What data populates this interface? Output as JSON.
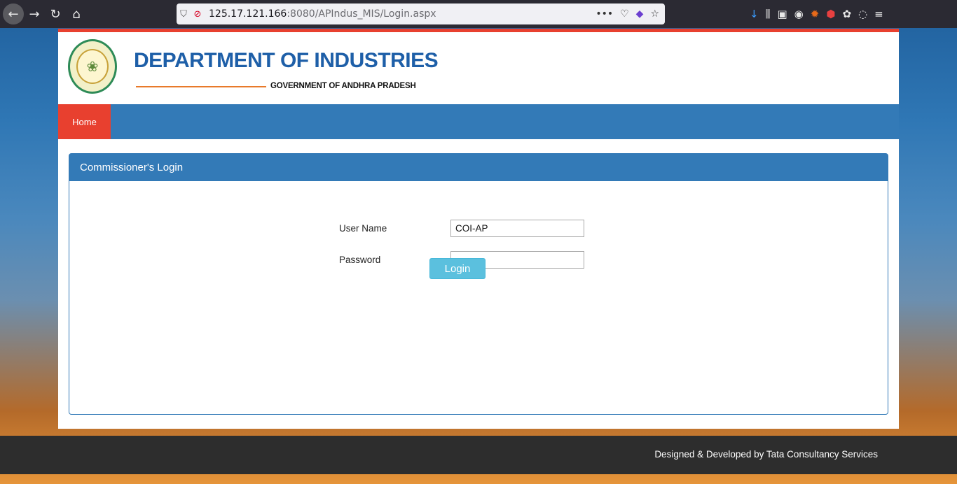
{
  "browser": {
    "url_host": "125.17.121.166",
    "url_rest": ":8080/APIndus_MIS/Login.aspx"
  },
  "header": {
    "title": "DEPARTMENT OF INDUSTRIES",
    "subtitle": "GOVERNMENT OF ANDHRA PRADESH"
  },
  "nav": {
    "home_label": "Home"
  },
  "login_panel": {
    "title": "Commissioner's Login",
    "username_label": "User Name",
    "username_value": "COI-AP",
    "password_label": "Password",
    "password_value": "",
    "login_button": "Login"
  },
  "footer": {
    "credit": "Designed & Developed by Tata Consultancy Services"
  },
  "colors": {
    "brand_blue": "#337ab7",
    "accent_red": "#e8402f",
    "button_cyan": "#5bc0de"
  }
}
